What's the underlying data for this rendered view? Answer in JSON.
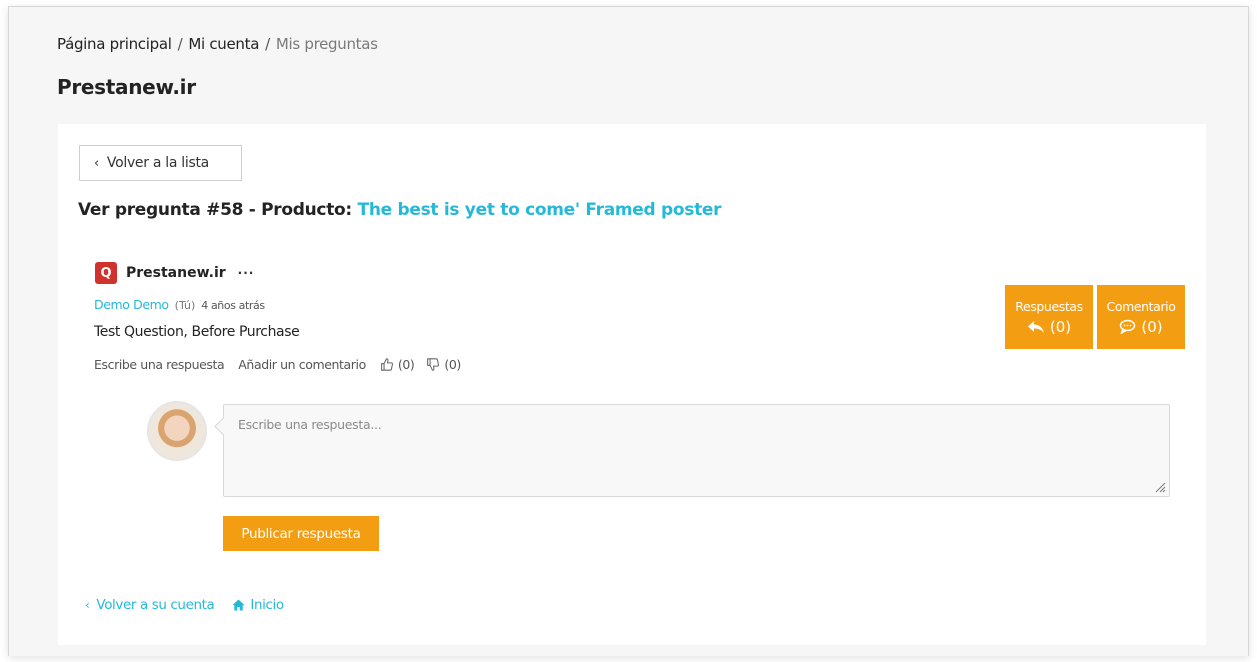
{
  "breadcrumb": {
    "home": "Página principal",
    "separator": "/",
    "account": "Mi cuenta",
    "current": "Mis preguntas"
  },
  "page_title": "Prestanew.ir",
  "back_button": {
    "label": "Volver a la lista",
    "icon": "chevron-left-icon"
  },
  "question": {
    "heading_prefix": "Ver pregunta #58 - Producto: ",
    "product_name": "The best is yet to come' Framed poster",
    "author": {
      "logo_letter": "Q",
      "name": "Prestanew.ir",
      "more": "···"
    },
    "user": "Demo Demo",
    "you_tag": "(Tú)",
    "time_ago": "4 años atrás",
    "text": "Test Question, Before Purchase",
    "actions": {
      "reply": "Escribe una respuesta",
      "comment": "Añadir un comentario",
      "likes": "(0)",
      "dislikes": "(0)"
    }
  },
  "stats": {
    "replies": {
      "label": "Respuestas",
      "count": "(0)",
      "icon": "reply-icon"
    },
    "comments": {
      "label": "Comentario",
      "count": "(0)",
      "icon": "comment-icon"
    }
  },
  "reply_form": {
    "placeholder": "Escribe una respuesta...",
    "submit": "Publicar respuesta"
  },
  "footer": {
    "back_account": "Volver a su cuenta",
    "home": "Inicio"
  },
  "colors": {
    "accent": "#f39d12",
    "link": "#25b9d7",
    "logo": "#d0332e"
  }
}
